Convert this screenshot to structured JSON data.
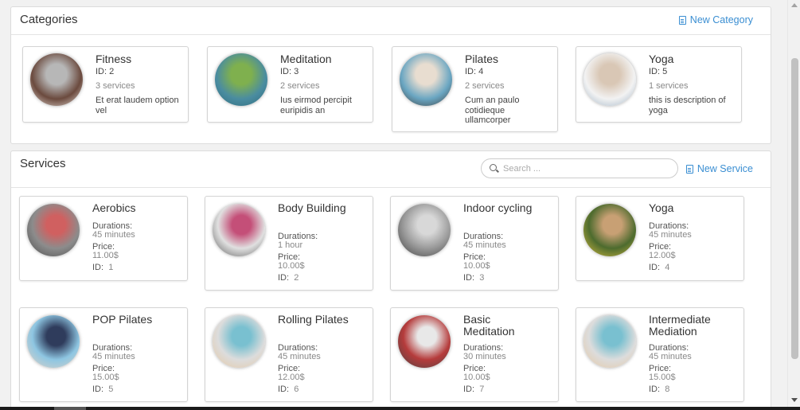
{
  "categories": {
    "title": "Categories",
    "new_label": "New Category",
    "items": [
      {
        "name": "Fitness",
        "id": "ID: 2",
        "count": "3 services",
        "desc": "Et erat laudem option vel",
        "colors": [
          "#6b4a3e",
          "#b7b7b7",
          "#e9e2dc"
        ]
      },
      {
        "name": "Meditation",
        "id": "ID: 3",
        "count": "2 services",
        "desc": "Ius eirmod percipit euripidis an",
        "colors": [
          "#4a8ca0",
          "#7fb04e",
          "#2f6b7c"
        ]
      },
      {
        "name": "Pilates",
        "id": "ID: 4",
        "count": "2 services",
        "desc": "Cum an paulo cotidieque ullamcorper",
        "colors": [
          "#6aa6c2",
          "#e8ddd0",
          "#3b3b3b"
        ]
      },
      {
        "name": "Yoga",
        "id": "ID: 5",
        "count": "1 services",
        "desc": "this is description of yoga",
        "colors": [
          "#f2f2f2",
          "#d9c7b5",
          "#9bb0c3"
        ]
      }
    ]
  },
  "services": {
    "title": "Services",
    "new_label": "New Service",
    "search_placeholder": "Search ...",
    "durations_label": "Durations:",
    "price_label": "Price:",
    "id_label": "ID:",
    "items": [
      {
        "name": "Aerobics",
        "duration": "45 minutes",
        "price": "11.00$",
        "id": "1",
        "colors": [
          "#8c8c8c",
          "#d06060",
          "#4a4a4a"
        ]
      },
      {
        "name": "Body Building",
        "duration": "1 hour",
        "price": "10.00$",
        "id": "2",
        "colors": [
          "#e0e0e0",
          "#c44f78",
          "#555"
        ]
      },
      {
        "name": "Indoor cycling",
        "duration": "45 minutes",
        "price": "10.00$",
        "id": "3",
        "colors": [
          "#9a9a9a",
          "#d8d8d8",
          "#3c3c3c"
        ]
      },
      {
        "name": "Yoga",
        "duration": "45 minutes",
        "price": "12.00$",
        "id": "4",
        "colors": [
          "#4d6b2e",
          "#c8a074",
          "#e0c040"
        ]
      },
      {
        "name": "POP Pilates",
        "duration": "45 minutes",
        "price": "15.00$",
        "id": "5",
        "colors": [
          "#8ec6e2",
          "#2f3c5c",
          "#e6d3c4"
        ]
      },
      {
        "name": "Rolling Pilates",
        "duration": "45 minutes",
        "price": "12.00$",
        "id": "6",
        "colors": [
          "#dcdcdc",
          "#79c0d0",
          "#e6c79e"
        ]
      },
      {
        "name": "Basic Meditation",
        "duration": "30 minutes",
        "price": "10.00$",
        "id": "7",
        "colors": [
          "#b53b3b",
          "#e8e8e8",
          "#444"
        ]
      },
      {
        "name": "Intermediate Mediation",
        "duration": "45 minutes",
        "price": "15.00$",
        "id": "8",
        "colors": [
          "#dcdcdc",
          "#79c0d0",
          "#e6c79e"
        ]
      }
    ]
  }
}
